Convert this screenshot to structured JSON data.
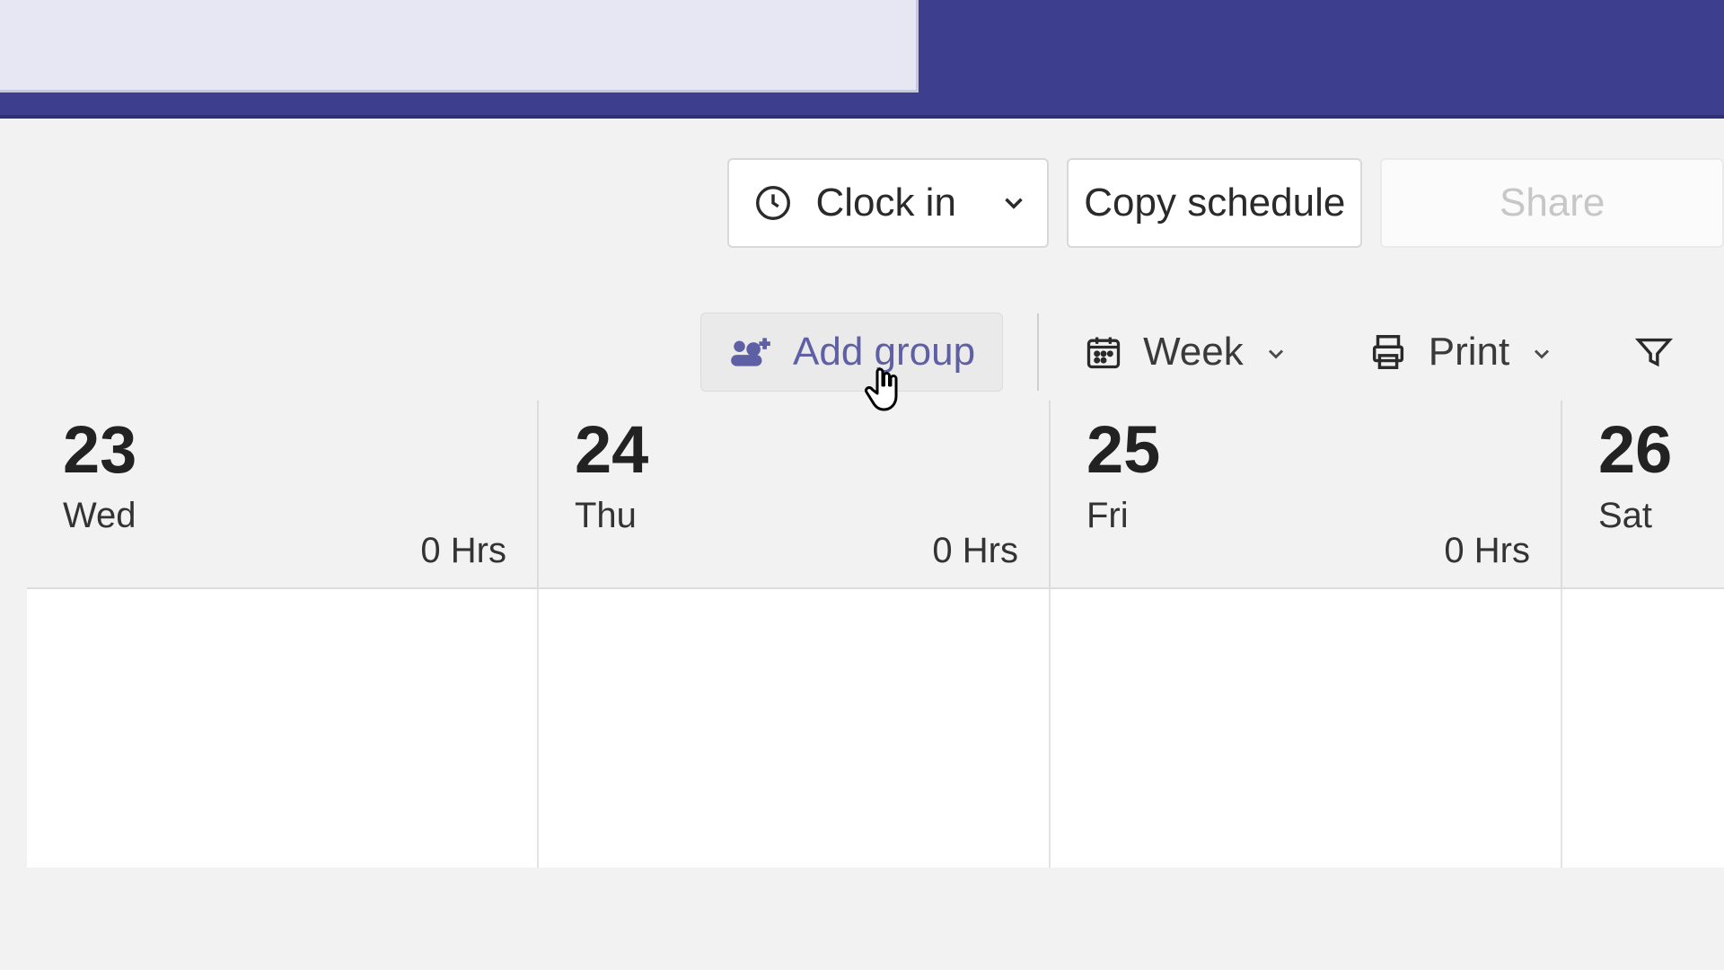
{
  "actions": {
    "clock_in": "Clock in",
    "copy_schedule": "Copy schedule",
    "share": "Share"
  },
  "toolbar": {
    "add_group": "Add group",
    "week": "Week",
    "print": "Print"
  },
  "tooltip": {
    "add_group": "Add group"
  },
  "calendar": {
    "cols": [
      {
        "num": "23",
        "day": "Wed",
        "hrs": "0 Hrs"
      },
      {
        "num": "24",
        "day": "Thu",
        "hrs": "0 Hrs"
      },
      {
        "num": "25",
        "day": "Fri",
        "hrs": "0 Hrs"
      },
      {
        "num": "26",
        "day": "Sat",
        "hrs": ""
      }
    ]
  },
  "colors": {
    "brand": "#3e3e8f",
    "accent": "#5f5fa6"
  }
}
